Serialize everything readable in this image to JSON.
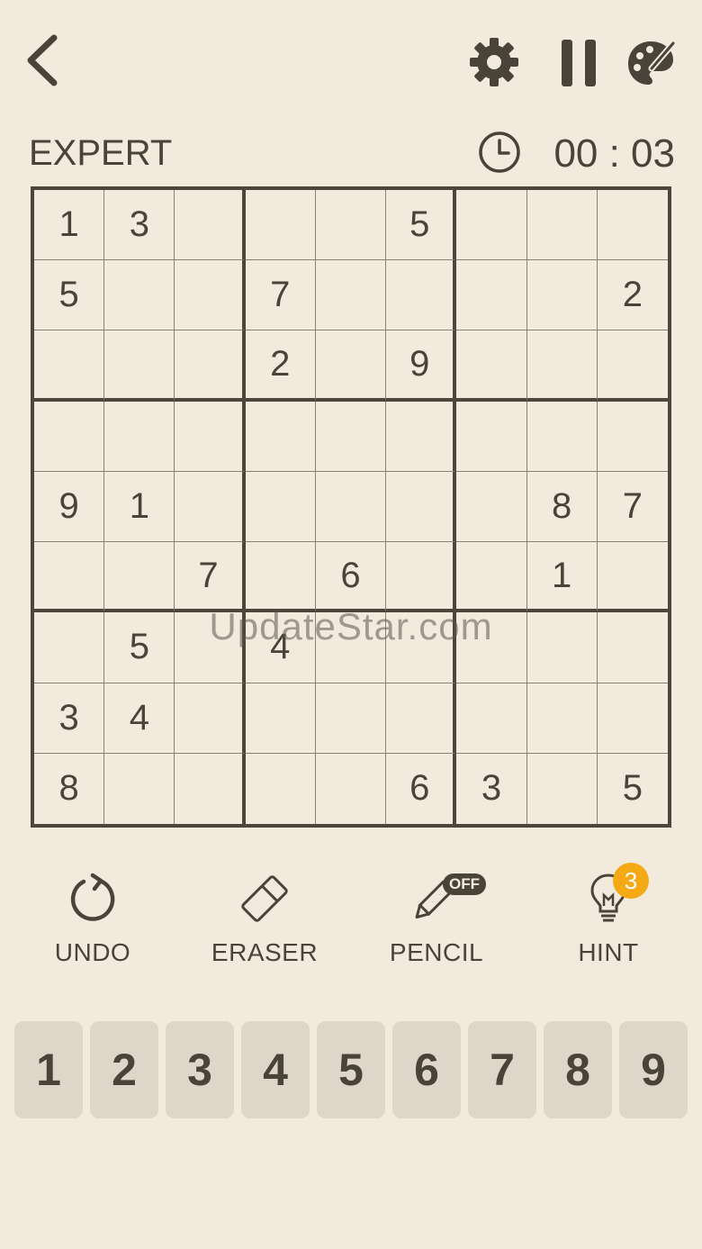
{
  "header": {
    "icons": [
      "back-icon",
      "gear-icon",
      "pause-icon",
      "palette-icon"
    ]
  },
  "status": {
    "difficulty": "EXPERT",
    "timer": "00 : 03"
  },
  "board": {
    "cells": [
      [
        "1",
        "3",
        "",
        "",
        "",
        "5",
        "",
        "",
        ""
      ],
      [
        "5",
        "",
        "",
        "7",
        "",
        "",
        "",
        "",
        "2"
      ],
      [
        "",
        "",
        "",
        "2",
        "",
        "9",
        "",
        "",
        ""
      ],
      [
        "",
        "",
        "",
        "",
        "",
        "",
        "",
        "",
        ""
      ],
      [
        "9",
        "1",
        "",
        "",
        "",
        "",
        "",
        "8",
        "7"
      ],
      [
        "",
        "",
        "7",
        "",
        "6",
        "",
        "",
        "1",
        ""
      ],
      [
        "",
        "5",
        "",
        "4",
        "",
        "",
        "",
        "",
        ""
      ],
      [
        "3",
        "4",
        "",
        "",
        "",
        "",
        "",
        "",
        ""
      ],
      [
        "8",
        "",
        "",
        "",
        "",
        "6",
        "3",
        "",
        "5"
      ]
    ]
  },
  "watermark": "UpdateStar.com",
  "tools": {
    "undo": "UNDO",
    "eraser": "ERASER",
    "pencil": "PENCIL",
    "pencil_state": "OFF",
    "hint": "HINT",
    "hint_count": "3"
  },
  "numpad": [
    "1",
    "2",
    "3",
    "4",
    "5",
    "6",
    "7",
    "8",
    "9"
  ],
  "colors": {
    "background": "#f2ebdd",
    "text": "#4a4339",
    "grid": "#4f463b",
    "key": "#ddd6c9",
    "hint_badge": "#f5a915"
  }
}
